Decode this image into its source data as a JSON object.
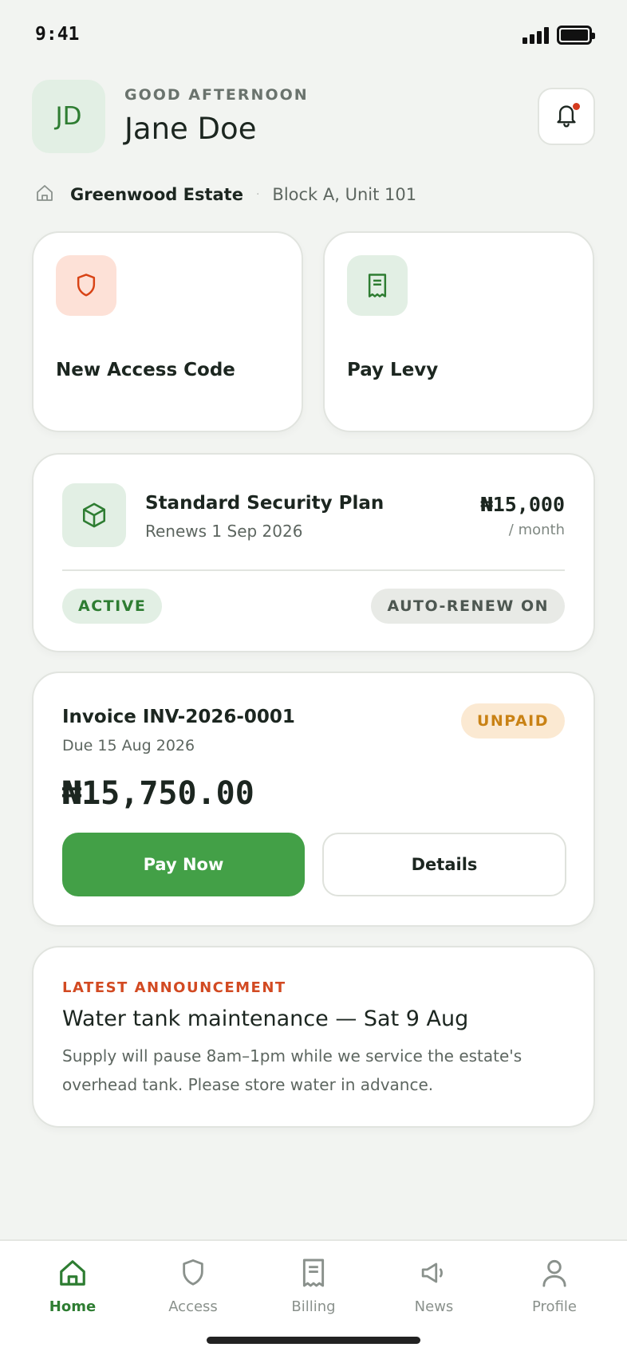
{
  "status_bar": {
    "time": "9:41"
  },
  "header": {
    "avatar_initials": "JD",
    "greeting": "GOOD AFTERNOON",
    "user_name": "Jane Doe"
  },
  "estate": {
    "name": "Greenwood Estate",
    "separator": "·",
    "unit": "Block A, Unit 101"
  },
  "quick_actions": [
    {
      "label": "New Access Code",
      "icon": "shield-icon",
      "accent": "#d84315",
      "bg": "#fde1d7"
    },
    {
      "label": "Pay Levy",
      "icon": "receipt-icon",
      "accent": "#2e7d32",
      "bg": "#e2efe4"
    }
  ],
  "plan": {
    "name": "Standard Security Plan",
    "renews": "Renews 1 Sep 2026",
    "price": "₦15,000",
    "period": "/ month",
    "status": "ACTIVE",
    "auto_renew": "AUTO-RENEW ON",
    "icon": "box-icon"
  },
  "invoice": {
    "title": "Invoice INV-2026-0001",
    "due": "Due 15 Aug 2026",
    "status": "UNPAID",
    "amount": "₦15,750.00",
    "pay_label": "Pay Now",
    "details_label": "Details"
  },
  "announcement": {
    "label": "LATEST ANNOUNCEMENT",
    "title": "Water tank maintenance — Sat 9 Aug",
    "body": "Supply will pause 8am–1pm while we service the estate's overhead tank. Please store water in advance."
  },
  "tabs": [
    {
      "label": "Home",
      "icon": "home-icon",
      "active": true
    },
    {
      "label": "Access",
      "icon": "shield-icon",
      "active": false
    },
    {
      "label": "Billing",
      "icon": "receipt-icon",
      "active": false
    },
    {
      "label": "News",
      "icon": "megaphone-icon",
      "active": false
    },
    {
      "label": "Profile",
      "icon": "person-icon",
      "active": false
    }
  ],
  "colors": {
    "brand_green": "#43a047",
    "dark_green": "#2e7d32",
    "alert_red": "#d43a1e",
    "announcement_orange": "#d24a22",
    "unpaid_amber": "#c98215",
    "background": "#f2f4f1"
  }
}
